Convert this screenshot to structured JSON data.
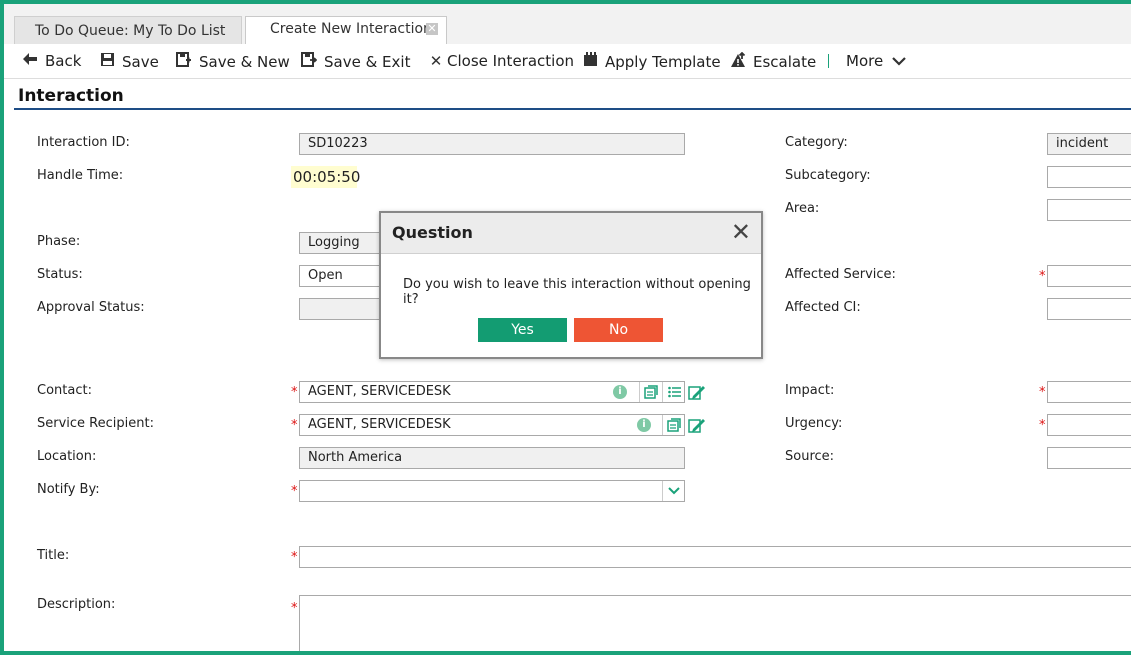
{
  "tabs": [
    {
      "label": "To Do Queue: My To Do List"
    },
    {
      "label": "Create New Interaction",
      "close_icon": "⊠"
    }
  ],
  "toolbar": {
    "back": "Back",
    "save": "Save",
    "save_new": "Save & New",
    "save_exit": "Save & Exit",
    "close_interaction": "Close Interaction",
    "apply_template": "Apply Template",
    "escalate": "Escalate",
    "more": "More",
    "icons": [
      "back-arrow-icon",
      "floppy-icon",
      "save-new-icon",
      "save-exit-icon",
      "close-x-icon",
      "template-icon",
      "escalate-icon",
      "chevron-down-icon"
    ]
  },
  "section": {
    "title": "Interaction"
  },
  "form": {
    "interaction_id": {
      "label": "Interaction ID:",
      "value": "SD10223"
    },
    "handle_time": {
      "label": "Handle Time:",
      "value": "00:05:50"
    },
    "phase": {
      "label": "Phase:",
      "value": "Logging"
    },
    "status": {
      "label": "Status:",
      "value": "Open"
    },
    "approval_status": {
      "label": "Approval Status:",
      "value": ""
    },
    "contact": {
      "label": "Contact:",
      "value": "AGENT, SERVICEDESK"
    },
    "service_recipient": {
      "label": "Service Recipient:",
      "value": "AGENT, SERVICEDESK"
    },
    "location": {
      "label": "Location:",
      "value": "North America"
    },
    "notify_by": {
      "label": "Notify By:",
      "value": ""
    },
    "title": {
      "label": "Title:",
      "value": ""
    },
    "description": {
      "label": "Description:",
      "value": ""
    },
    "category": {
      "label": "Category:",
      "value": "incident"
    },
    "subcategory": {
      "label": "Subcategory:",
      "value": ""
    },
    "area": {
      "label": "Area:",
      "value": ""
    },
    "affected_service": {
      "label": "Affected Service:",
      "value": ""
    },
    "affected_ci": {
      "label": "Affected CI:",
      "value": ""
    },
    "impact": {
      "label": "Impact:",
      "value": ""
    },
    "urgency": {
      "label": "Urgency:",
      "value": ""
    },
    "source": {
      "label": "Source:",
      "value": ""
    },
    "required_mark": "*"
  },
  "dialog": {
    "title": "Question",
    "message": "Do you wish to leave this interaction without opening it?",
    "yes": "Yes",
    "no": "No"
  },
  "colors": {
    "accent": "#1aa27a",
    "yes": "#139c72",
    "no": "#ee5534",
    "rule": "#1e4d86"
  }
}
